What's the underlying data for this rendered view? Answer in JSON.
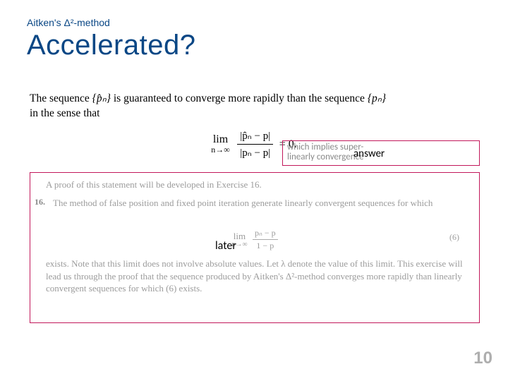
{
  "header": {
    "method_line": "Aitken's Δ²-method",
    "title": "Accelerated?"
  },
  "body": {
    "sentence_pre": "The sequence ",
    "seq_hat": "{p̂ₙ}",
    "sentence_mid": " is guaranteed to converge more rapidly than the sequence ",
    "seq_plain": "{pₙ}",
    "sentence_post": " in the sense that",
    "lim_word": "lim",
    "lim_sub": "n→∞",
    "frac_top": "|p̂ₙ − p|",
    "frac_bot": "|pₙ − p|",
    "eq_rhs": " = 0."
  },
  "answer": {
    "faint_line1": "which implies super-",
    "faint_line2": "linearly convergence",
    "label": "answer"
  },
  "proofbox": {
    "line1": "A proof of this statement will be developed in Exercise 16.",
    "exnum": "16.",
    "line2": "The method of false position and fixed point iteration generate linearly convergent sequences for which",
    "smalleq_lhs": "lim",
    "smalleq_sub": "n→∞",
    "smalleq_num": "pₙ − p",
    "smalleq_den": "1 − p",
    "six": "(6)",
    "later": "later",
    "line3": "exists. Note that this limit does not involve absolute values. Let λ denote the value of this limit. This exercise will lead us through the proof that the sequence produced by Aitken's Δ²-method converges more rapidly than linearly convergent sequences for which (6) exists."
  },
  "page": {
    "number": "10"
  }
}
